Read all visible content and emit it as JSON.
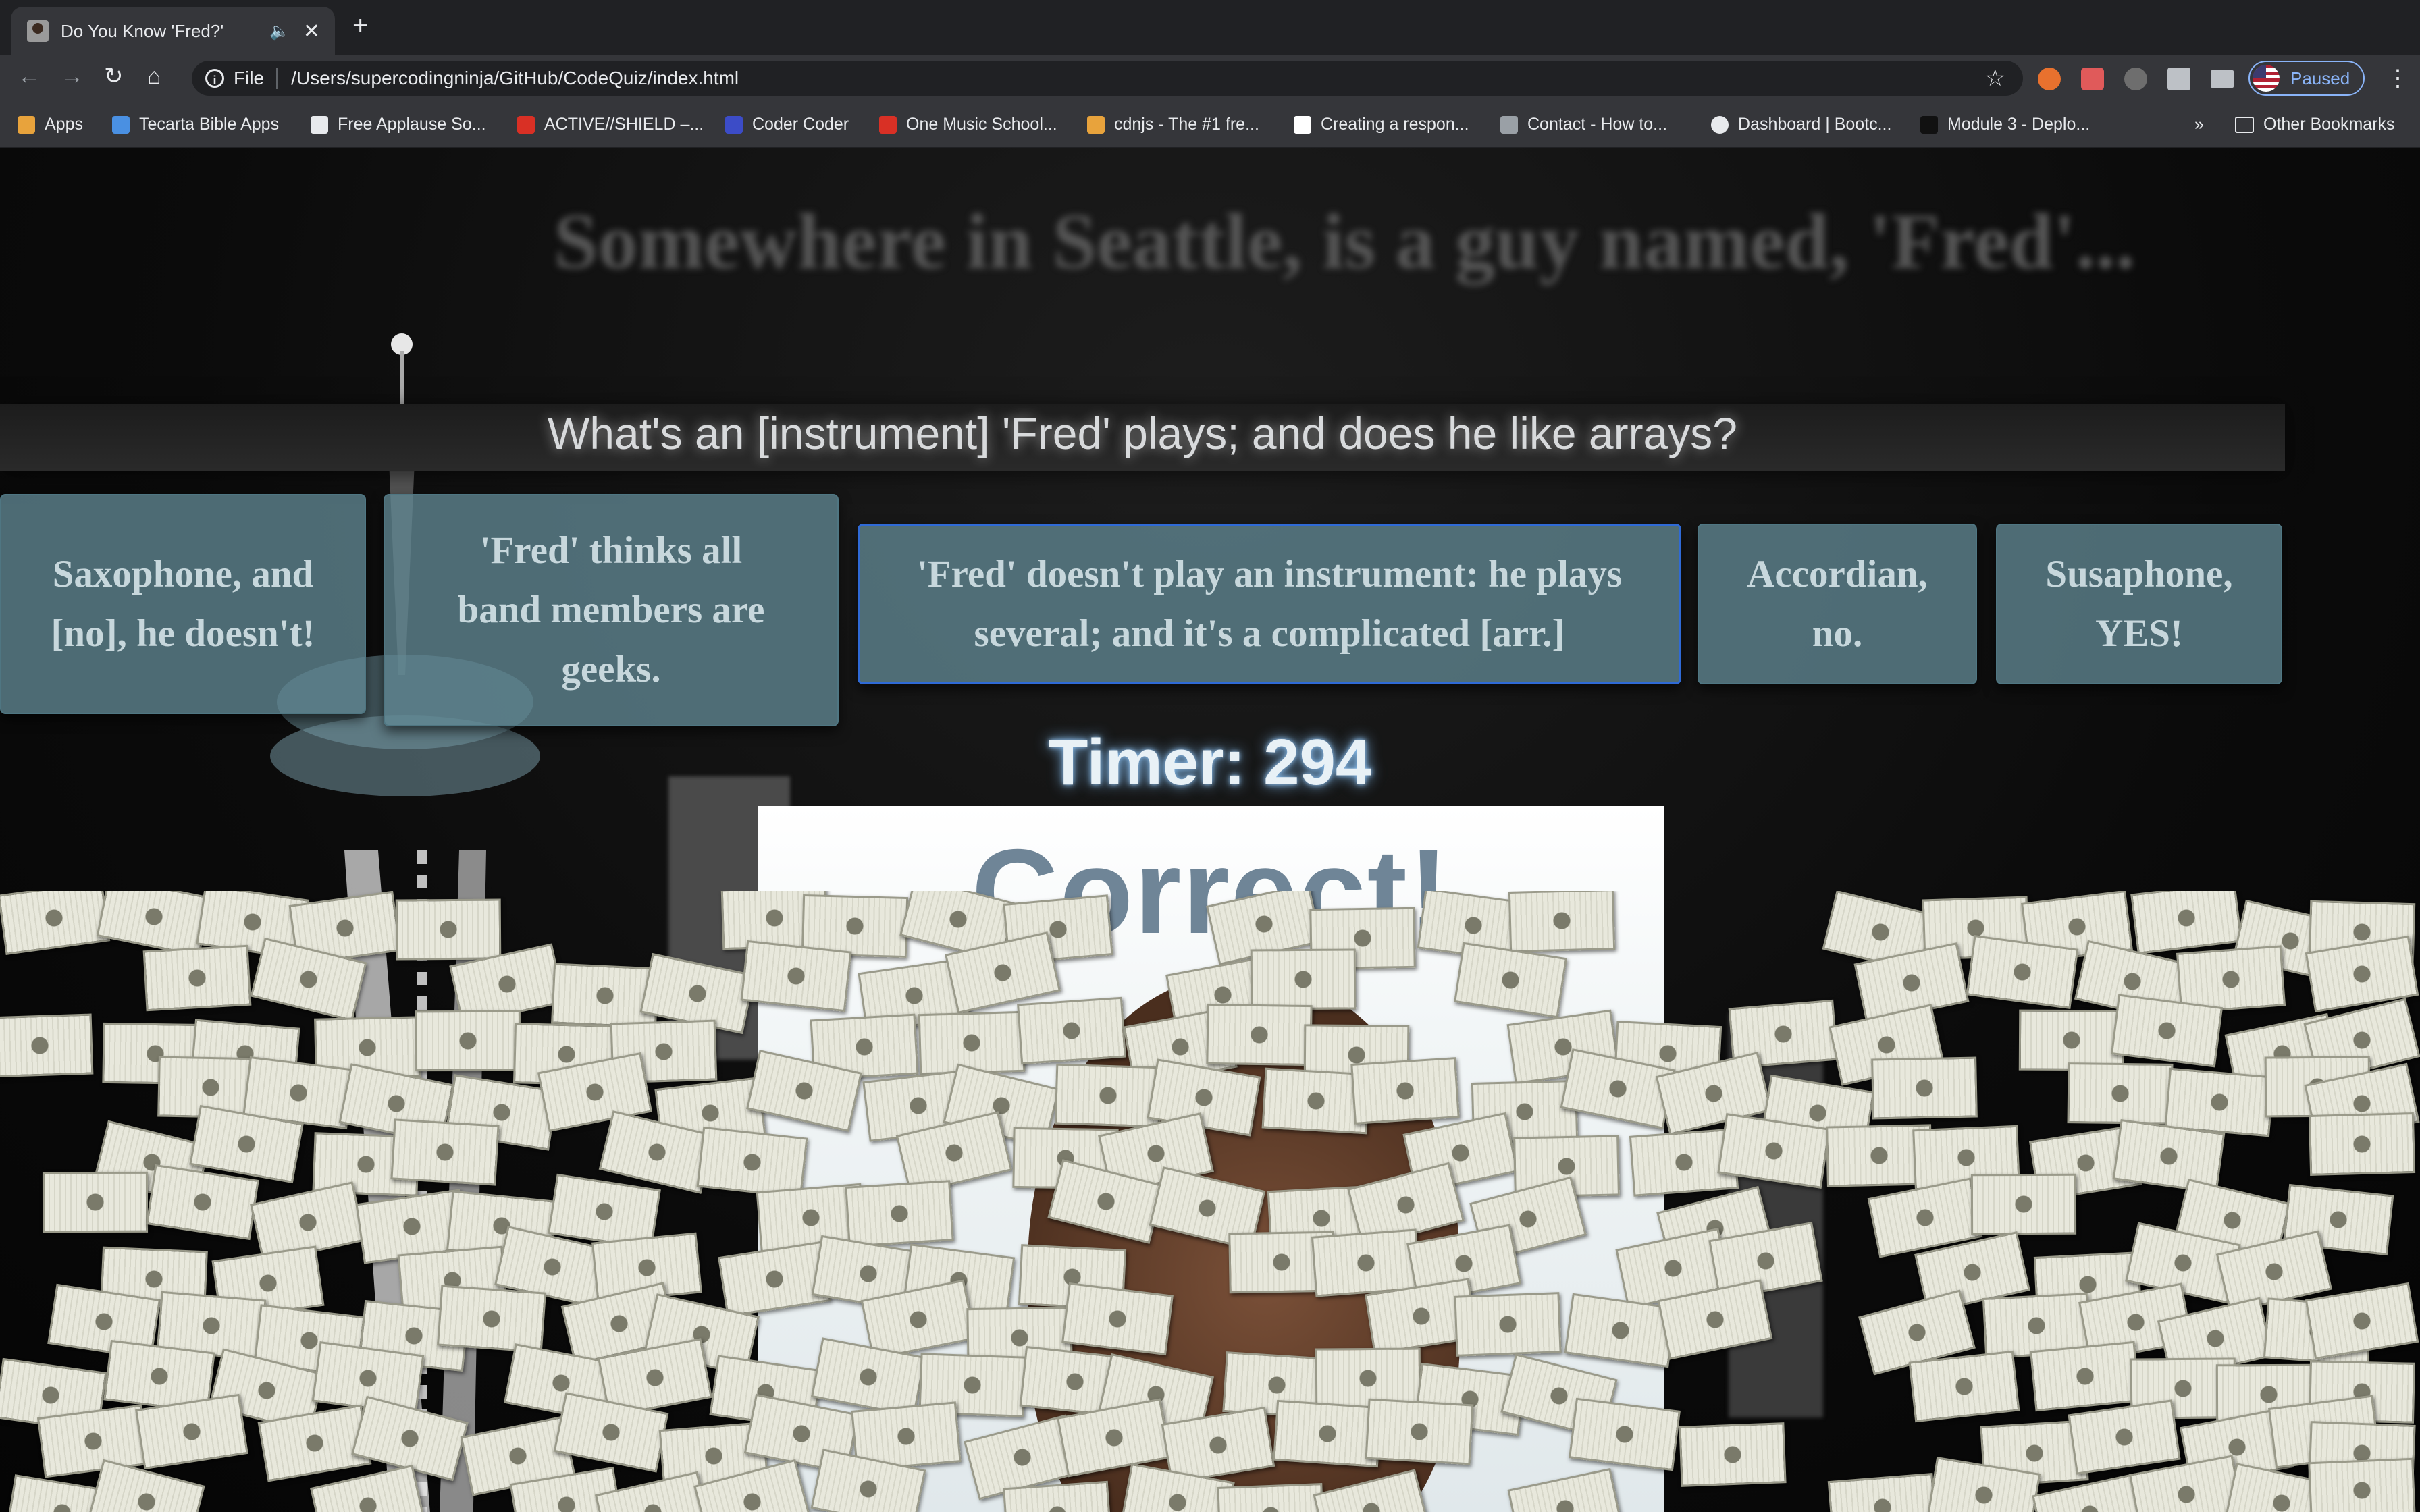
{
  "browser": {
    "tab_title": "Do You Know 'Fred?'",
    "audio_icon": "🔈",
    "close_icon": "✕",
    "new_tab_icon": "+",
    "back_icon": "←",
    "forward_icon": "→",
    "reload_icon": "↻",
    "home_icon": "⌂",
    "info_icon": "i",
    "scheme": "File",
    "url": "/Users/supercodingninja/GitHub/CodeQuiz/index.html",
    "star_icon": "☆",
    "profile_label": "Paused",
    "menu_icon": "⋮"
  },
  "bookmarks": [
    {
      "label": "Apps",
      "color": "#e8a33c"
    },
    {
      "label": "Tecarta Bible Apps",
      "color": "#4a90e2"
    },
    {
      "label": "Free Applause So...",
      "color": "#e8eaed"
    },
    {
      "label": "ACTIVE//SHIELD –...",
      "color": "#d93025"
    },
    {
      "label": "Coder Coder",
      "color": "#3c4cc7"
    },
    {
      "label": "One Music School...",
      "color": "#d93025"
    },
    {
      "label": "cdnjs - The #1 fre...",
      "color": "#e8a33c"
    },
    {
      "label": "Creating a respon...",
      "color": "#ffffff"
    },
    {
      "label": "Contact - How to...",
      "color": "#9aa0a6"
    },
    {
      "label": "Dashboard | Bootc...",
      "color": "#e8eaed"
    },
    {
      "label": "Module 3 - Deplo...",
      "color": "#202124"
    }
  ],
  "bookmarks_overflow": "»",
  "other_bookmarks": "Other Bookmarks",
  "quiz": {
    "headline": "Somewhere in Seattle, is a guy named, 'Fred'...",
    "question": "What's an [instrument] 'Fred' plays; and does he like arrays?",
    "answers": [
      "Saxophone, and [no], he doesn't!",
      "'Fred' thinks all band members are geeks.",
      "'Fred' doesn't play an instrument: he plays several; and it's a complicated [arr.]",
      "Accordian, no.",
      "Susaphone, YES!"
    ],
    "timer": "Timer: 294",
    "result": "Correct!"
  }
}
